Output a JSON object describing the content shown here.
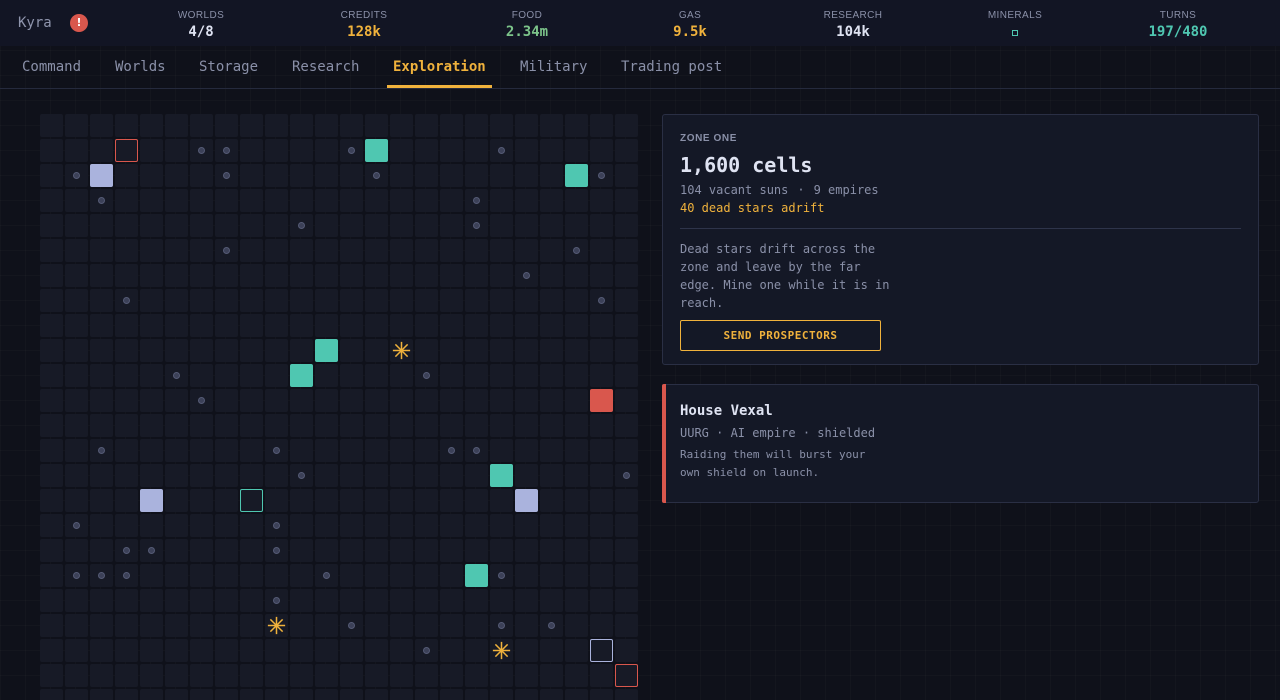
{
  "header": {
    "player_name": "Kyra",
    "alert_icon": "!",
    "stats": [
      {
        "label": "WORLDS",
        "value": "4/8",
        "color": "white"
      },
      {
        "label": "CREDITS",
        "value": "128k",
        "color": "yellow"
      },
      {
        "label": "FOOD",
        "value": "2.34m",
        "color": "green"
      },
      {
        "label": "GAS",
        "value": "9.5k",
        "color": "yellow"
      },
      {
        "label": "RESEARCH",
        "value": "104k",
        "color": "white"
      },
      {
        "label": "MINERALS",
        "value": "",
        "icon": "mineral-square-icon",
        "color": "teal"
      },
      {
        "label": "TURNS",
        "value": "197/480",
        "color": "teal"
      }
    ]
  },
  "nav": {
    "tabs": [
      {
        "label": "Command"
      },
      {
        "label": "Worlds"
      },
      {
        "label": "Storage"
      },
      {
        "label": "Research"
      },
      {
        "label": "Exploration",
        "active": true
      },
      {
        "label": "Military"
      },
      {
        "label": "Trading post"
      }
    ]
  },
  "map": {
    "columns": 24,
    "rows": 24,
    "dot_cells": [
      [
        1,
        6
      ],
      [
        1,
        7
      ],
      [
        1,
        12
      ],
      [
        1,
        18
      ],
      [
        2,
        1
      ],
      [
        2,
        7
      ],
      [
        2,
        13
      ],
      [
        2,
        22
      ],
      [
        3,
        2
      ],
      [
        3,
        17
      ],
      [
        4,
        10
      ],
      [
        4,
        17
      ],
      [
        5,
        7
      ],
      [
        5,
        21
      ],
      [
        6,
        19
      ],
      [
        7,
        3
      ],
      [
        7,
        22
      ],
      [
        10,
        5
      ],
      [
        10,
        15
      ],
      [
        11,
        6
      ],
      [
        13,
        2
      ],
      [
        13,
        9
      ],
      [
        13,
        16
      ],
      [
        13,
        17
      ],
      [
        14,
        10
      ],
      [
        14,
        23
      ],
      [
        16,
        1
      ],
      [
        16,
        9
      ],
      [
        17,
        3
      ],
      [
        17,
        4
      ],
      [
        17,
        9
      ],
      [
        18,
        1
      ],
      [
        18,
        2
      ],
      [
        18,
        3
      ],
      [
        18,
        11
      ],
      [
        18,
        18
      ],
      [
        19,
        9
      ],
      [
        20,
        12
      ],
      [
        20,
        18
      ],
      [
        20,
        20
      ],
      [
        21,
        15
      ]
    ],
    "tokens": [
      {
        "cell": [
          1,
          3
        ],
        "kind": "enemy-outline"
      },
      {
        "cell": [
          1,
          13
        ],
        "kind": "own-world"
      },
      {
        "cell": [
          2,
          2
        ],
        "kind": "neutral-world"
      },
      {
        "cell": [
          2,
          21
        ],
        "kind": "own-world"
      },
      {
        "cell": [
          9,
          11
        ],
        "kind": "own-world"
      },
      {
        "cell": [
          10,
          10
        ],
        "kind": "own-world"
      },
      {
        "cell": [
          11,
          22
        ],
        "kind": "enemy-world"
      },
      {
        "cell": [
          14,
          18
        ],
        "kind": "own-world"
      },
      {
        "cell": [
          15,
          4
        ],
        "kind": "neutral-world"
      },
      {
        "cell": [
          15,
          8
        ],
        "kind": "own-outline"
      },
      {
        "cell": [
          15,
          19
        ],
        "kind": "neutral-world"
      },
      {
        "cell": [
          18,
          17
        ],
        "kind": "own-world"
      },
      {
        "cell": [
          21,
          22
        ],
        "kind": "neutral-outline"
      },
      {
        "cell": [
          22,
          23
        ],
        "kind": "enemy-outline"
      }
    ],
    "dead_stars": [
      [
        9,
        14
      ],
      [
        20,
        9
      ],
      [
        21,
        18
      ]
    ]
  },
  "zone_panel": {
    "label": "ZONE ONE",
    "title": "1,600 cells",
    "vacant": "104 vacant suns",
    "separator": "·",
    "empires": "9 empires",
    "warning": "40 dead stars adrift",
    "description": "Dead stars drift across the zone and leave by the far edge. Mine one while it is in reach.",
    "button_label": "SEND PROSPECTORS"
  },
  "house_panel": {
    "title": "House Vexal",
    "subtitle": "UURG · AI empire · shielded",
    "description": "Raiding them will burst your own shield on launch.",
    "accent": "#d9574d"
  },
  "colors": {
    "accent": "#f0b23c",
    "own_world": "#4fc7b1",
    "neutral_world": "#aab3dd",
    "enemy_world": "#d9574d",
    "dead_star": "#f0b23c",
    "cell": "#171a26",
    "dot": "#3c4158"
  }
}
